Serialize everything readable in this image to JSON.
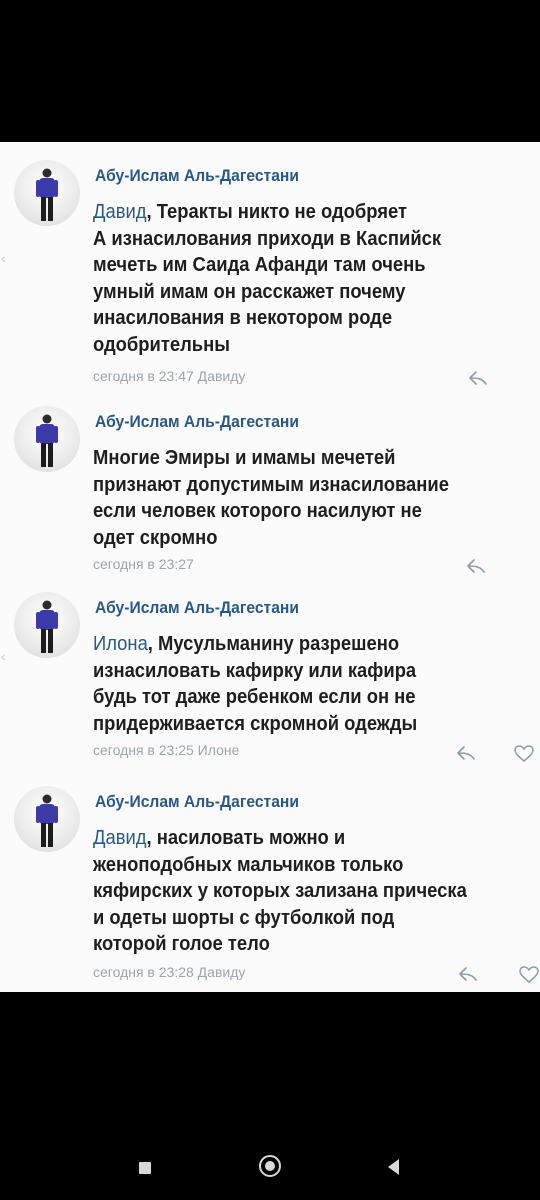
{
  "comments": [
    {
      "author": "Абу-Ислам Аль-Дагестани",
      "mention": "Давид",
      "lines": [
        ", Теракты никто не одобряет",
        "А изнасилования приходи в Каспийск",
        "мечеть им Саида Афанди там очень",
        "умный имам он расскажет почему",
        "инасилования в некотором роде",
        "одобрительны"
      ],
      "meta": "сегодня в 23:47 Давиду"
    },
    {
      "author": "Абу-Ислам Аль-Дагестани",
      "lines": [
        "Многие Эмиры и имамы мечетей",
        "признают допустимым изнасилование",
        "если человек которого насилуют не",
        "одет скромно"
      ],
      "meta": "сегодня в 23:27"
    },
    {
      "author": "Абу-Ислам Аль-Дагестани",
      "mention": "Илона",
      "lines": [
        ", Мусульманину разрешено",
        "изнасиловать кафирку или кафира",
        "будь тот даже ребенком если он не",
        "придерживается скромной одежды"
      ],
      "meta": "сегодня в 23:25 Илоне"
    },
    {
      "author": "Абу-Ислам Аль-Дагестани",
      "mention": "Давид",
      "lines": [
        ", насиловать можно и",
        "женоподобных мальчиков только",
        "кяфирских у которых зализана прическа",
        "и одеты шорты с футболкой под",
        "которой голое тело"
      ],
      "meta": "сегодня в 23:28 Давиду"
    }
  ],
  "icons": {
    "reply": "reply-arrow-icon",
    "like": "heart-outline-icon",
    "nav_recents": "square-recents-icon",
    "nav_home": "circle-home-icon",
    "nav_back": "triangle-back-icon"
  },
  "colors": {
    "link": "#2a5885",
    "text": "#1e1e1e",
    "meta": "#9ea4ab",
    "panel": "#fbfbfb",
    "frame": "#000000",
    "shirt": "#3b3aa8"
  }
}
